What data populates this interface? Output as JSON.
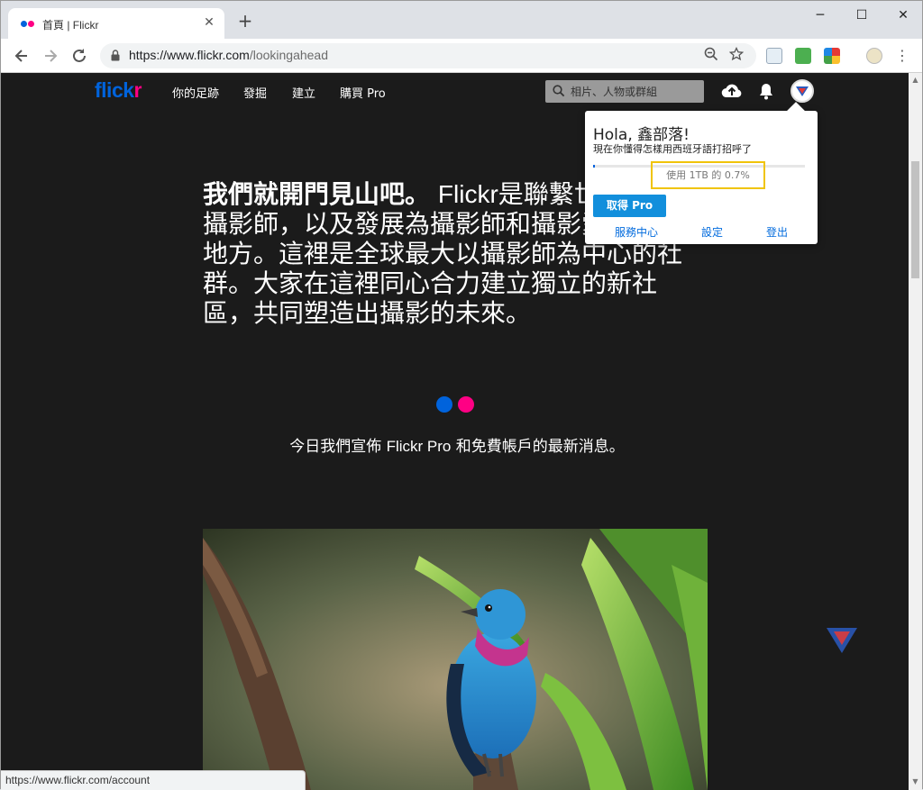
{
  "browser": {
    "tab_title": "首頁 | Flickr",
    "tab_close": "✕",
    "new_tab": "+",
    "window_controls": {
      "minimize": "─",
      "maximize": "☐",
      "close": "✕"
    },
    "url_host": "https://www.flickr.com",
    "url_path": "/lookingahead",
    "status_url": "https://www.flickr.com/account"
  },
  "header": {
    "logo_part1": "flick",
    "logo_part2": "r",
    "nav": [
      "你的足跡",
      "發掘",
      "建立",
      "購買 Pro"
    ],
    "search_placeholder": "相片、人物或群組"
  },
  "content": {
    "lead_bold": "我們就開門見山吧。",
    "lead_mid": "Flickr",
    "lead_rest": "是聯繫世界各地攝影師，以及發展為攝影師和攝影愛好者的地方。這裡是全球最大以攝影師為中心的社群。大家在這裡同心合力建立獨立的新社區，共同塑造出攝影的未來。",
    "announcement_pre": "今日我們宣佈",
    "announcement_brand": "Flickr Pro",
    "announcement_post": "和免費帳戶的最新消息。"
  },
  "account_menu": {
    "greeting": "Hola, 鑫部落!",
    "tagline": "現在你懂得怎樣用西班牙語打招呼了",
    "usage_label": "使用 1TB 的 0.7%",
    "usage_fraction": 0.007,
    "pro_button": "取得 Pro",
    "links": [
      "服務中心",
      "設定",
      "登出"
    ]
  },
  "colors": {
    "flickr_blue": "#0063dc",
    "flickr_pink": "#ff0084",
    "pro_button": "#128fdc",
    "highlight_box": "#f0c40a",
    "page_bg": "#1b1b1b"
  },
  "icons": [
    "back-arrow-icon",
    "forward-arrow-icon",
    "reload-icon",
    "lock-icon",
    "zoom-icon",
    "star-icon",
    "search-icon",
    "upload-cloud-icon",
    "bell-icon"
  ]
}
